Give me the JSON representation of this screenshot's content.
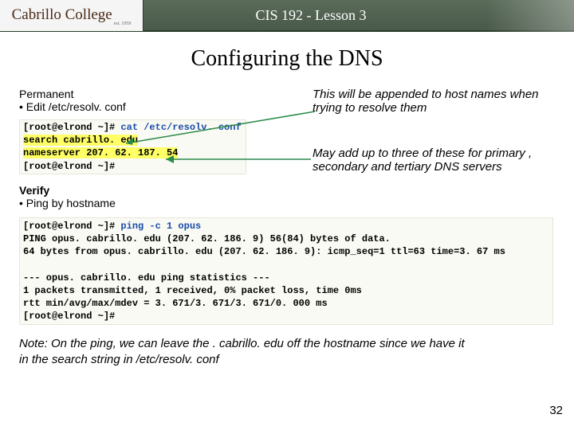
{
  "header": {
    "logo_text": "Cabrillo College",
    "logo_sub": "est. 1959",
    "title": "CIS 192 - Lesson 3"
  },
  "main_title": "Configuring the DNS",
  "permanent": {
    "heading": "Permanent",
    "bullet": "• Edit /etc/resolv. conf"
  },
  "codebox": {
    "line1_prompt": "[root@elrond ~]# ",
    "line1_cmd": "cat /etc/resolv. conf",
    "line2": "search cabrillo. edu",
    "line3": "nameserver 207. 62. 187. 54",
    "line4": "[root@elrond ~]#"
  },
  "notes": {
    "search_note": "This will be appended to host names when trying to resolve them",
    "ns_note": "May add up to three of these for primary , secondary and tertiary DNS servers"
  },
  "verify": {
    "heading": "Verify",
    "bullet": "• Ping by hostname"
  },
  "pingbox": {
    "line1_prompt": "[root@elrond ~]# ",
    "line1_cmd": "ping -c 1 opus",
    "body": "PING opus. cabrillo. edu (207. 62. 186. 9) 56(84) bytes of data.\n64 bytes from opus. cabrillo. edu (207. 62. 186. 9): icmp_seq=1 ttl=63 time=3. 67 ms\n\n--- opus. cabrillo. edu ping statistics ---\n1 packets transmitted, 1 received, 0% packet loss, time 0ms\nrtt min/avg/max/mdev = 3. 671/3. 671/3. 671/0. 000 ms\n[root@elrond ~]#"
  },
  "footnote": "Note:  On the ping, we can leave the . cabrillo. edu off the hostname since we have it in the search string in /etc/resolv. conf",
  "pagenum": "32"
}
